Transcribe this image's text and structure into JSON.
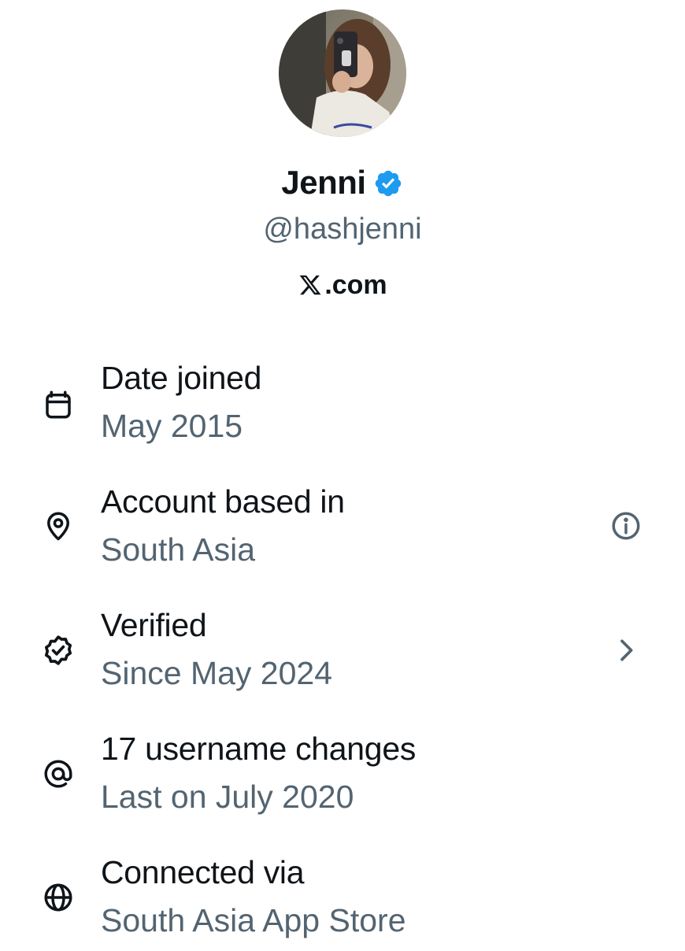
{
  "profile": {
    "display_name": "Jenni",
    "handle": "@hashjenni",
    "site": ".com",
    "verified_badge_color": "#1d9bf0"
  },
  "icons": {
    "avatar": "profile-photo",
    "verified": "verified-badge-icon",
    "site_logo": "x-logo-icon"
  },
  "details": [
    {
      "icon": "calendar-icon",
      "title": "Date joined",
      "value": "May 2015",
      "action": null
    },
    {
      "icon": "location-pin-icon",
      "title": "Account based in",
      "value": "South Asia",
      "action": "info-icon"
    },
    {
      "icon": "verified-check-icon",
      "title": "Verified",
      "value": "Since May 2024",
      "action": "chevron-right-icon"
    },
    {
      "icon": "at-sign-icon",
      "title": "17 username changes",
      "value": "Last on July 2020",
      "action": null
    },
    {
      "icon": "globe-icon",
      "title": "Connected via",
      "value": "South Asia App Store",
      "action": null
    }
  ],
  "colors": {
    "primary_text": "#0f1419",
    "secondary_text": "#536471",
    "background": "#ffffff"
  }
}
